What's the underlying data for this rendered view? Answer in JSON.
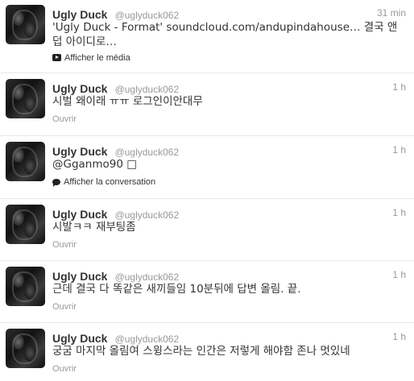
{
  "tweets": [
    {
      "name": "Ugly Duck",
      "handle": "@uglyduck062",
      "time": "31 min",
      "text": "'Ugly Duck - Format'  soundcloud.com/andupindahouse… 결국 앤덥 아이디로…",
      "action": "Afficher le média",
      "action_icon": "media-play-icon"
    },
    {
      "name": "Ugly Duck",
      "handle": "@uglyduck062",
      "time": "1 h",
      "text": "시벌 왜이래 ㅠㅠ  로그인이안대무",
      "action": "Ouvrir"
    },
    {
      "name": "Ugly Duck",
      "handle": "@uglyduck062",
      "time": "1 h",
      "text": "@Gganmo90 □",
      "action": "Afficher la conversation",
      "action_icon": "conversation-bubble-icon"
    },
    {
      "name": "Ugly Duck",
      "handle": "@uglyduck062",
      "time": "1 h",
      "text": "시발ㅋㅋ 재부팅좀",
      "action": "Ouvrir"
    },
    {
      "name": "Ugly Duck",
      "handle": "@uglyduck062",
      "time": "1 h",
      "text": "근데 결국 다 똑같은 새끼들임 10분뒤에 답변 올림. 끝.",
      "action": "Ouvrir"
    },
    {
      "name": "Ugly Duck",
      "handle": "@uglyduck062",
      "time": "1 h",
      "text": "궁굼 마지막 올림여 스윙스라는 인간은 저렇게 해야함 존나 멋있네",
      "action": "Ouvrir"
    }
  ]
}
